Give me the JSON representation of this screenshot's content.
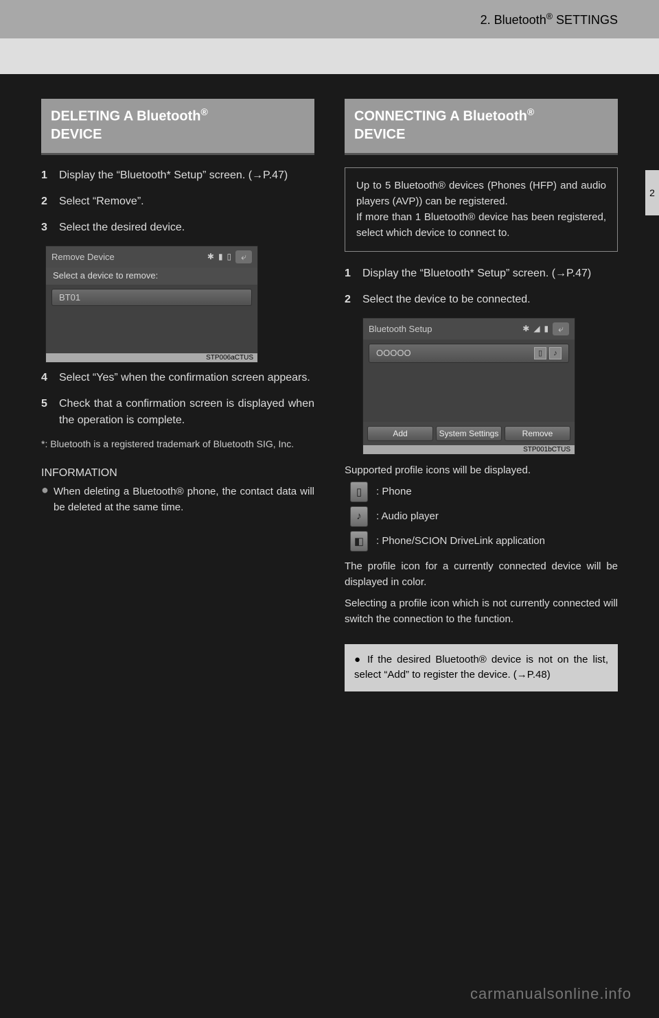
{
  "header": {
    "breadcrumb_prefix": "2. Bluetooth",
    "breadcrumb_suffix": " SETTINGS",
    "side_tab": "2"
  },
  "left": {
    "title_l1": "DELETING A Bluetooth",
    "title_l2": "DEVICE",
    "step1": "Display the “Bluetooth* Setup” screen. (→P.47)",
    "step2": "Select “Remove”.",
    "step3": "Select the desired device.",
    "shot": {
      "title": "Remove Device",
      "sub": "Select a device to remove:",
      "row1": "BT01",
      "caption": "STP006aCTUS"
    },
    "step4": "Select “Yes” when the confirmation screen appears.",
    "step5": "Check that a confirmation screen is displayed when the operation is complete.",
    "footnote": "*: Bluetooth is a registered trademark of Bluetooth SIG, Inc.",
    "info_header": "INFORMATION",
    "info_bullet": "When deleting a Bluetooth® phone, the contact data will be deleted at the same time."
  },
  "right": {
    "title_l1": "CONNECTING A Bluetooth",
    "title_l2": "DEVICE",
    "intro": "Up to 5 Bluetooth® devices (Phones (HFP) and audio players (AVP)) can be registered.\nIf more than 1 Bluetooth® device has been registered, select which device to connect to.",
    "step1": "Display the “Bluetooth* Setup” screen. (→P.47)",
    "step2": "Select the device to be connected.",
    "shot": {
      "title": "Bluetooth Setup",
      "row1": "OOOOO",
      "btn_add": "Add",
      "btn_sys": "System Settings",
      "btn_remove": "Remove",
      "caption": "STP001bCTUS"
    },
    "icons_lead": "Supported profile icons will be displayed.",
    "icon_phone": ": Phone",
    "icon_audio": ": Audio player",
    "icon_sdl": ": Phone/SCION DriveLink application",
    "after1": "The profile icon for a currently connected device will be displayed in color.",
    "after2": "Selecting a profile icon which is not currently connected will switch the connection to the function.",
    "note": "If the desired Bluetooth® device is not on the list, select “Add” to register the device. (→P.48)"
  },
  "watermark": "carmanualsonline.info"
}
